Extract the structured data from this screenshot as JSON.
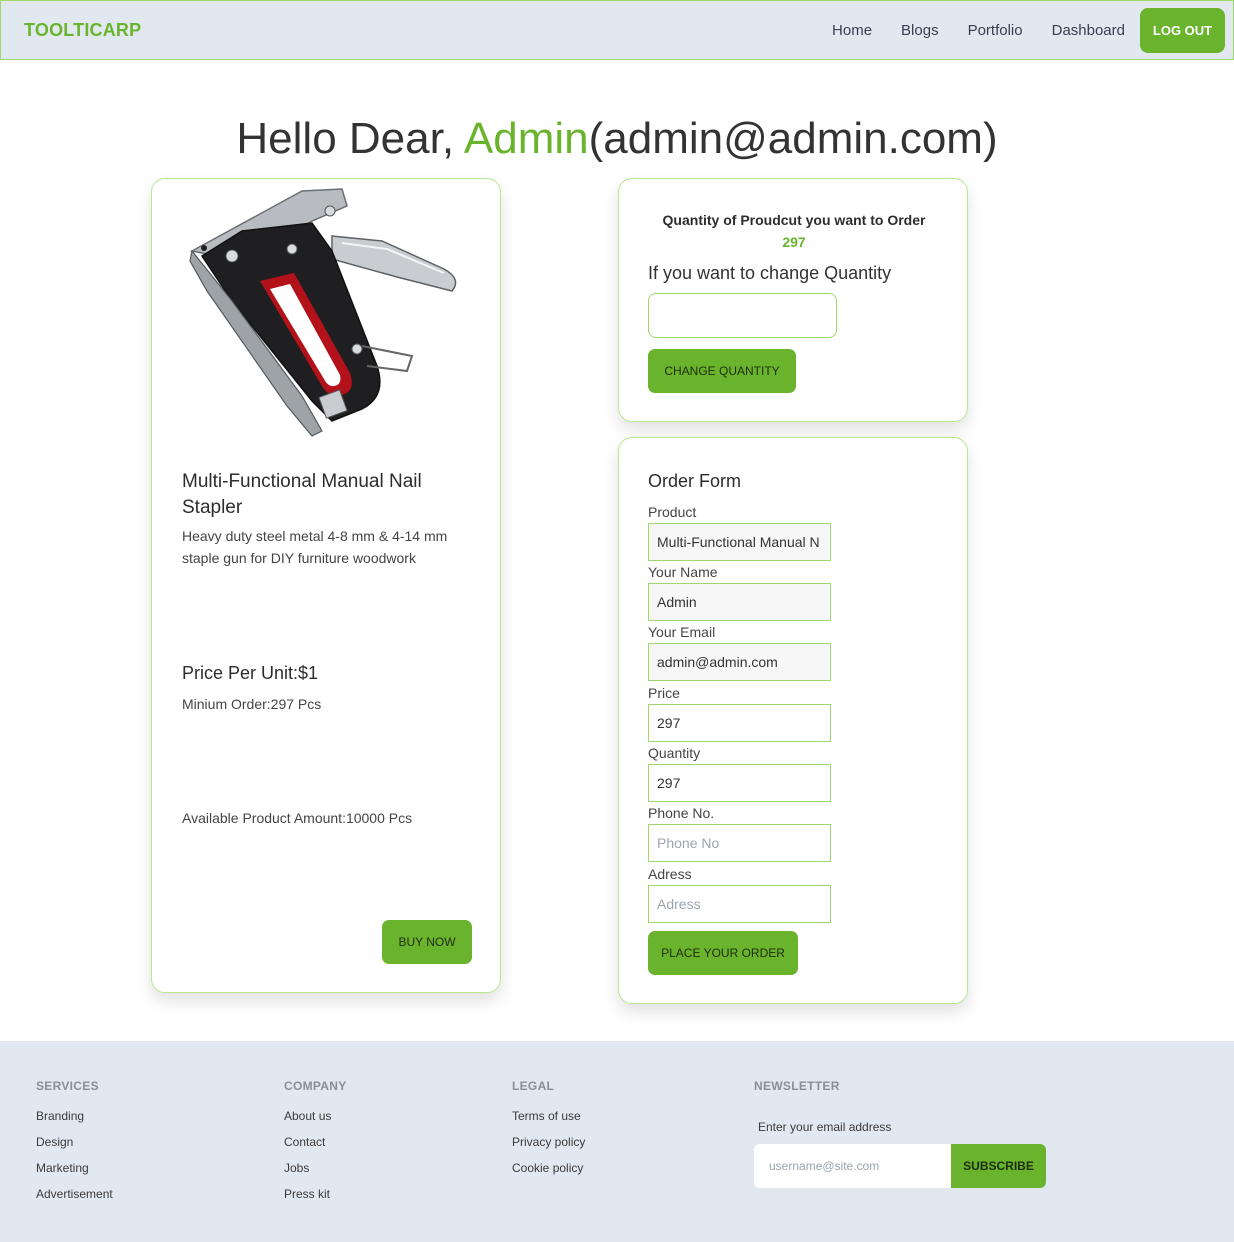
{
  "navbar": {
    "brand": "TOOLTICARP",
    "links": [
      "Home",
      "Blogs",
      "Portfolio",
      "Dashboard"
    ],
    "logout_label": "LOG OUT"
  },
  "greeting": {
    "prefix": "Hello Dear, ",
    "name": "Admin",
    "email": "(admin@admin.com)"
  },
  "product": {
    "image_icon": "stapler-image",
    "title": "Multi-Functional Manual Nail Stapler",
    "description": "Heavy duty steel metal 4-8 mm & 4-14 mm staple gun for DIY furniture woodwork",
    "price": "Price Per Unit:$1",
    "min_order": "Minium Order:297 Pcs",
    "available": "Available Product Amount:10000 Pcs",
    "buy_label": "BUY NOW"
  },
  "quantity": {
    "title": "Quantity of Proudcut you want to Order",
    "value": "297",
    "change_label": "If you want to change Quantity",
    "input_value": "",
    "button_label": "CHANGE QUANTITY"
  },
  "order_form": {
    "title": "Order Form",
    "fields": [
      {
        "label": "Product",
        "value": "Multi-Functional Manual N",
        "placeholder": ""
      },
      {
        "label": "Your Name",
        "value": "Admin",
        "placeholder": ""
      },
      {
        "label": "Your Email",
        "value": "admin@admin.com",
        "placeholder": ""
      },
      {
        "label": "Price",
        "value": "297",
        "placeholder": ""
      },
      {
        "label": "Quantity",
        "value": "297",
        "placeholder": ""
      },
      {
        "label": "Phone No.",
        "value": "",
        "placeholder": "Phone No"
      },
      {
        "label": "Adress",
        "value": "",
        "placeholder": "Adress"
      }
    ],
    "submit_label": "PLACE YOUR ORDER"
  },
  "footer": {
    "services": {
      "title": "SERVICES",
      "links": [
        "Branding",
        "Design",
        "Marketing",
        "Advertisement"
      ]
    },
    "company": {
      "title": "COMPANY",
      "links": [
        "About us",
        "Contact",
        "Jobs",
        "Press kit"
      ]
    },
    "legal": {
      "title": "LEGAL",
      "links": [
        "Terms of use",
        "Privacy policy",
        "Cookie policy"
      ]
    },
    "newsletter": {
      "title": "NEWSLETTER",
      "label": "Enter your email address",
      "placeholder": "username@site.com",
      "button_label": "SUBSCRIBE"
    }
  },
  "colors": {
    "accent": "#6ab42d",
    "border": "#9cd86a",
    "navbar_bg": "#e2e8f0"
  }
}
